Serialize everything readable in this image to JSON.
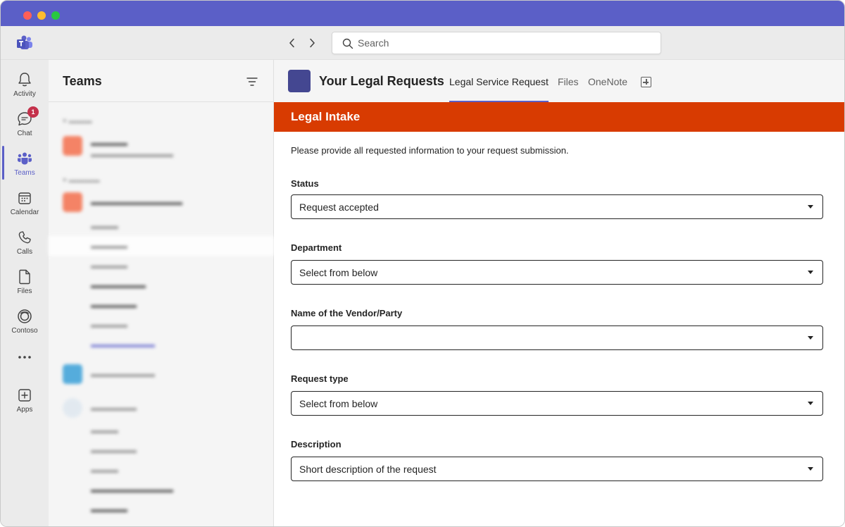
{
  "topbar": {
    "search_placeholder": "Search"
  },
  "rail": {
    "items": [
      {
        "label": "Activity",
        "icon": "bell-icon"
      },
      {
        "label": "Chat",
        "icon": "chat-icon",
        "badge": "1"
      },
      {
        "label": "Teams",
        "icon": "teams-icon",
        "active": true
      },
      {
        "label": "Calendar",
        "icon": "calendar-icon"
      },
      {
        "label": "Calls",
        "icon": "phone-icon"
      },
      {
        "label": "Files",
        "icon": "file-icon"
      },
      {
        "label": "Contoso",
        "icon": "contoso-icon"
      },
      {
        "label": "",
        "icon": "more-icon"
      },
      {
        "label": "Apps",
        "icon": "apps-icon"
      }
    ]
  },
  "teams_panel": {
    "title": "Teams"
  },
  "main": {
    "team_title": "Your Legal Requests",
    "tabs": [
      {
        "label": "Legal Service Request",
        "active": true
      },
      {
        "label": "Files"
      },
      {
        "label": "OneNote"
      }
    ]
  },
  "form": {
    "banner": "Legal Intake",
    "intro": "Please provide all requested information to your request submission.",
    "fields": [
      {
        "label": "Status",
        "value": "Request accepted"
      },
      {
        "label": "Department",
        "value": "Select from below"
      },
      {
        "label": "Name of the Vendor/Party",
        "value": ""
      },
      {
        "label": "Request type",
        "value": "Select from below"
      },
      {
        "label": "Description",
        "value": "Short description of the request"
      }
    ]
  },
  "colors": {
    "brand": "#5b5fc7",
    "banner": "#d83b01",
    "team_tile": "#444791",
    "badge": "#c4314b"
  }
}
